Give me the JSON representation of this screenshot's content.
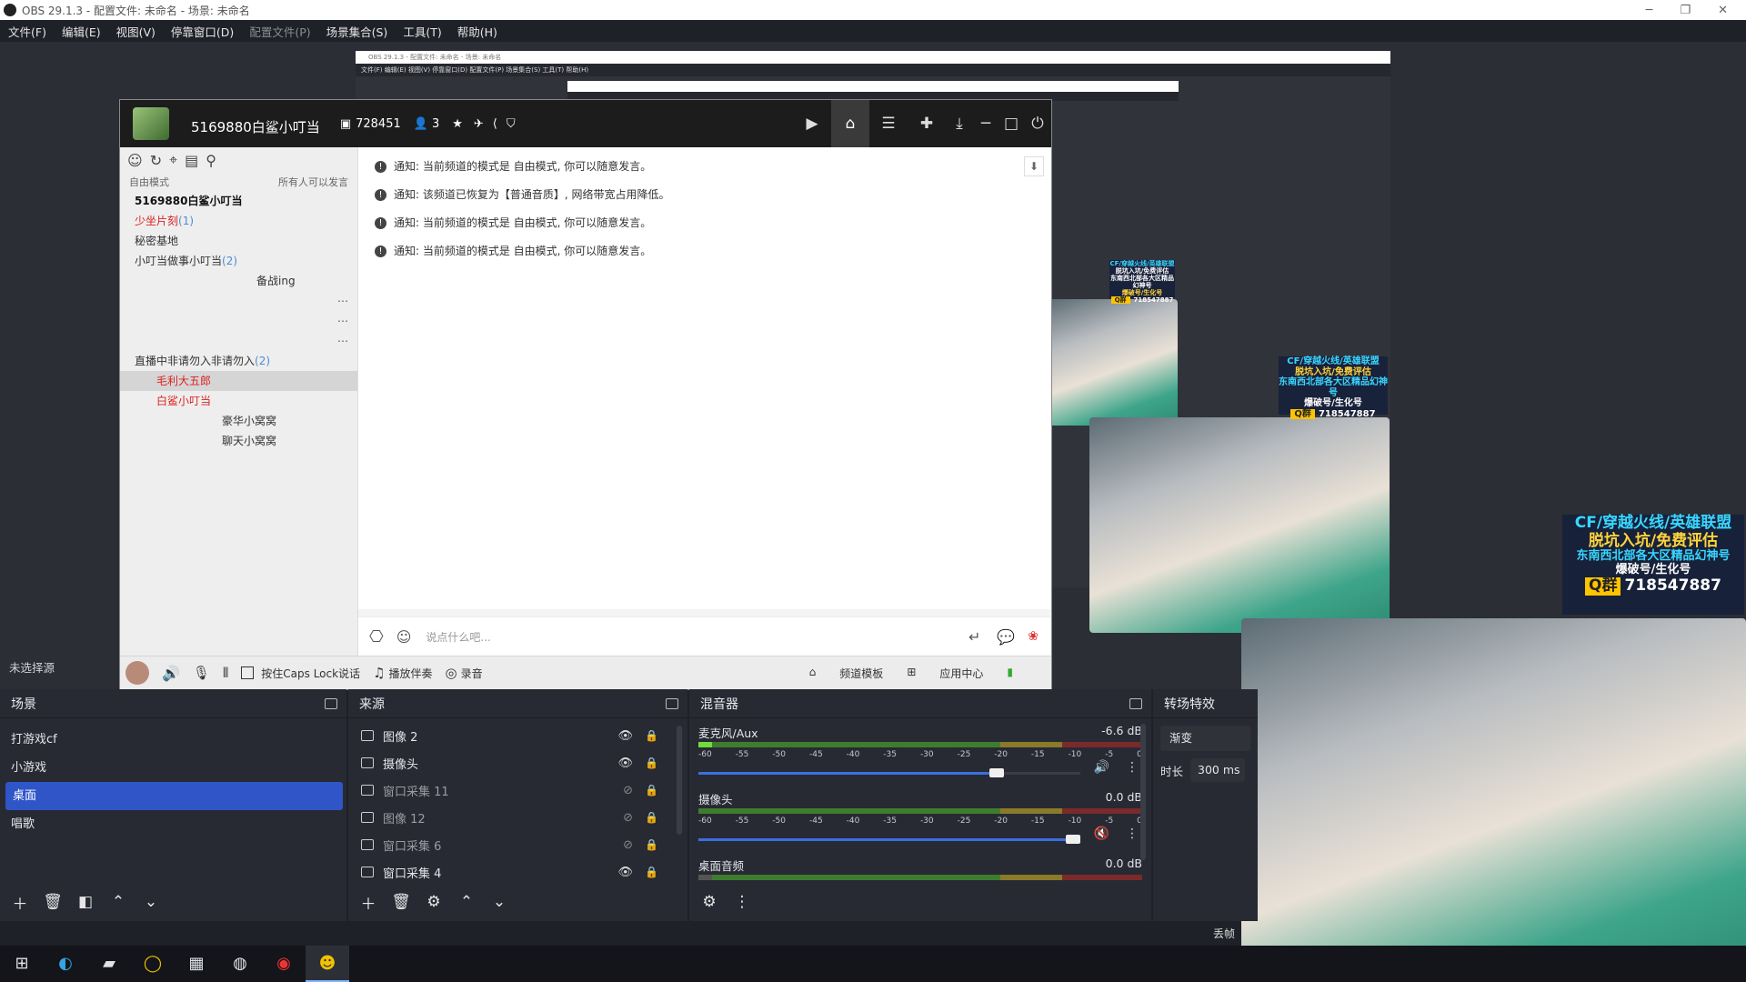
{
  "titlebar": {
    "title": "OBS 29.1.3 - 配置文件: 未命名 - 场景: 未命名"
  },
  "menu": [
    "文件(F)",
    "编辑(E)",
    "视图(V)",
    "停靠窗口(D)",
    "配置文件(P)",
    "场景集合(S)",
    "工具(T)",
    "帮助(H)"
  ],
  "nested": {
    "title": "OBS 29.1.3 - 配置文件: 未命名 - 场景: 未命名",
    "menu": "文件(F)   编辑(E)   视图(V)   停靠窗口(D)   配置文件(P)   场景集合(S)   工具(T)   帮助(H)"
  },
  "yy": {
    "channel": "5169880白鲨小叮当",
    "online": "728451",
    "users": "3",
    "mode": "自由模式",
    "perm": "所有人可以发言",
    "tree": [
      {
        "label": "5169880白鲨小叮当",
        "style": "b"
      },
      {
        "label": "少坐片刻",
        "count": "(1)",
        "style": "r"
      },
      {
        "label": "秘密基地",
        "style": ""
      },
      {
        "label": "小叮当做事小叮当",
        "count": "(2)",
        "style": ""
      },
      {
        "label": "备战ing",
        "style": "indent"
      },
      {
        "label": "直播中非请勿入非请勿入",
        "count": "(2)",
        "style": ""
      },
      {
        "label": "毛利大五郎",
        "style": "r sel"
      },
      {
        "label": "白鲨小叮当",
        "style": "r"
      },
      {
        "label": "豪华小窝窝",
        "style": "indent"
      },
      {
        "label": "聊天小窝窝",
        "style": "indent"
      }
    ],
    "messages": [
      "通知: 当前频道的模式是 自由模式, 你可以随意发言。",
      "通知: 该频道已恢复为【普通音质】, 网络带宽占用降低。",
      "通知: 当前频道的模式是 自由模式, 你可以随意发言。",
      "通知: 当前频道的模式是 自由模式, 你可以随意发言。"
    ],
    "input_placeholder": "说点什么吧...",
    "footer": {
      "caps": "按住Caps Lock说话",
      "music": "播放伴奏",
      "record": "录音",
      "template": "频道模板",
      "apps": "应用中心"
    }
  },
  "promo": {
    "line1": "CF/穿越火线/英雄联盟",
    "line2": "脱坑入坑/免费评估",
    "line3": "东南西北部各大区精品幻神号",
    "line4": "爆破号/生化号",
    "qq_label": "Q群",
    "qq": "718547887"
  },
  "no_source": "未选择源",
  "scenes": {
    "title": "场景",
    "items": [
      "打游戏cf",
      "小游戏",
      "桌面",
      "唱歌"
    ],
    "active": "桌面"
  },
  "sources": {
    "title": "来源",
    "items": [
      {
        "label": "图像 2",
        "visible": true
      },
      {
        "label": "摄像头",
        "visible": true
      },
      {
        "label": "窗口采集 11",
        "visible": false
      },
      {
        "label": "图像 12",
        "visible": false
      },
      {
        "label": "窗口采集 6",
        "visible": false
      },
      {
        "label": "窗口采集 4",
        "visible": true
      }
    ]
  },
  "mixer": {
    "title": "混音器",
    "channels": [
      {
        "name": "麦克风/Aux",
        "db": "-6.6 dB",
        "level": 0.78,
        "muted": false
      },
      {
        "name": "摄像头",
        "db": "0.0 dB",
        "level": 0.98,
        "muted": true
      },
      {
        "name": "桌面音频",
        "db": "0.0 dB",
        "level": 0.98,
        "muted": false
      }
    ],
    "ticks": [
      "-60",
      "-55",
      "-50",
      "-45",
      "-40",
      "-35",
      "-30",
      "-25",
      "-20",
      "-15",
      "-10",
      "-5",
      "0"
    ]
  },
  "transitions": {
    "title": "转场特效",
    "type": "渐变",
    "duration_label": "时长",
    "duration": "300 ms"
  },
  "status": {
    "dropped": "丢帧"
  }
}
